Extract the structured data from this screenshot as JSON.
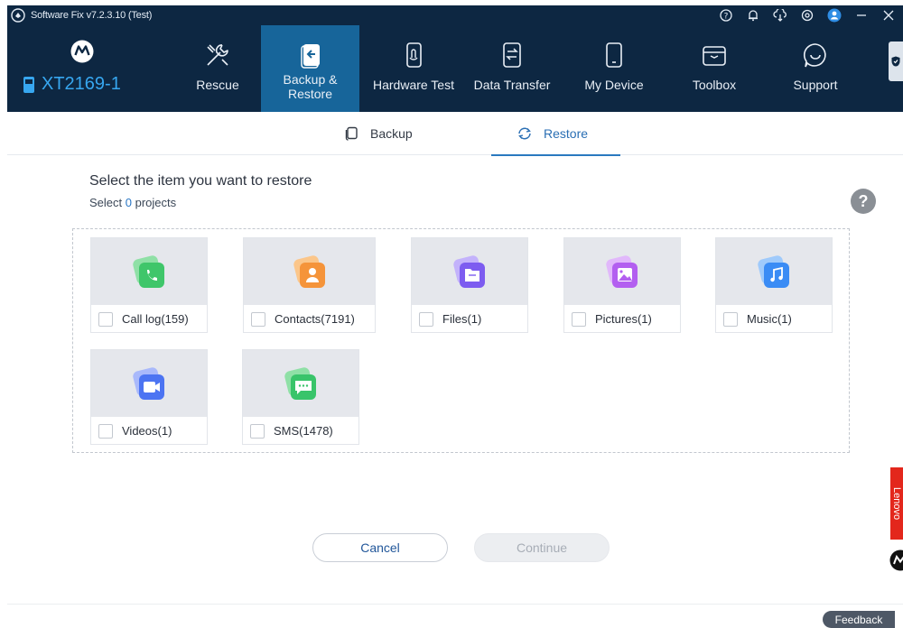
{
  "titlebar": {
    "title": "Software Fix v7.2.3.10 (Test)",
    "icons": [
      "help-circle-icon",
      "bell-icon",
      "cloud-download-icon",
      "settings-icon",
      "user-icon",
      "minimize-icon",
      "close-icon"
    ]
  },
  "brand": {
    "logo": "motorola-logo",
    "device_name": "XT2169-1"
  },
  "nav": {
    "items": [
      {
        "label": "Rescue",
        "icon": "tools-icon"
      },
      {
        "label": "Backup & Restore",
        "icon": "backup-icon",
        "active": true
      },
      {
        "label": "Hardware Test",
        "icon": "hardware-test-icon"
      },
      {
        "label": "Data Transfer",
        "icon": "data-transfer-icon"
      },
      {
        "label": "My Device",
        "icon": "phone-icon"
      },
      {
        "label": "Toolbox",
        "icon": "toolbox-icon"
      },
      {
        "label": "Support",
        "icon": "chat-support-icon"
      }
    ]
  },
  "subtabs": [
    {
      "label": "Backup",
      "icon": "backup-copy-icon"
    },
    {
      "label": "Restore",
      "icon": "restore-icon",
      "active": true
    }
  ],
  "main": {
    "heading": "Select the item you want to restore",
    "select_prefix": "Select ",
    "select_count": "0",
    "select_suffix": " projects",
    "help_glyph": "?"
  },
  "items": [
    {
      "label": "Call log(159)",
      "icon": "call-log-icon",
      "color": "#3fc66a"
    },
    {
      "label": "Contacts(7191)",
      "icon": "contacts-icon",
      "color": "#f5943a"
    },
    {
      "label": "Files(1)",
      "icon": "files-icon",
      "color": "#7d5cf0"
    },
    {
      "label": "Pictures(1)",
      "icon": "pictures-icon",
      "color": "#b35ff0"
    },
    {
      "label": "Music(1)",
      "icon": "music-icon",
      "color": "#3a8cf5"
    },
    {
      "label": "Videos(1)",
      "icon": "videos-icon",
      "color": "#4c74f2"
    },
    {
      "label": "SMS(1478)",
      "icon": "sms-icon",
      "color": "#39c46a"
    }
  ],
  "buttons": {
    "cancel": "Cancel",
    "continue": "Continue"
  },
  "footer": {
    "feedback": "Feedback",
    "lenovo": "Lenovo"
  },
  "colors": {
    "header_bg": "#0d2742",
    "nav_active_bg": "#17659a",
    "device_name": "#37a7f0",
    "accent": "#2a79c0"
  }
}
